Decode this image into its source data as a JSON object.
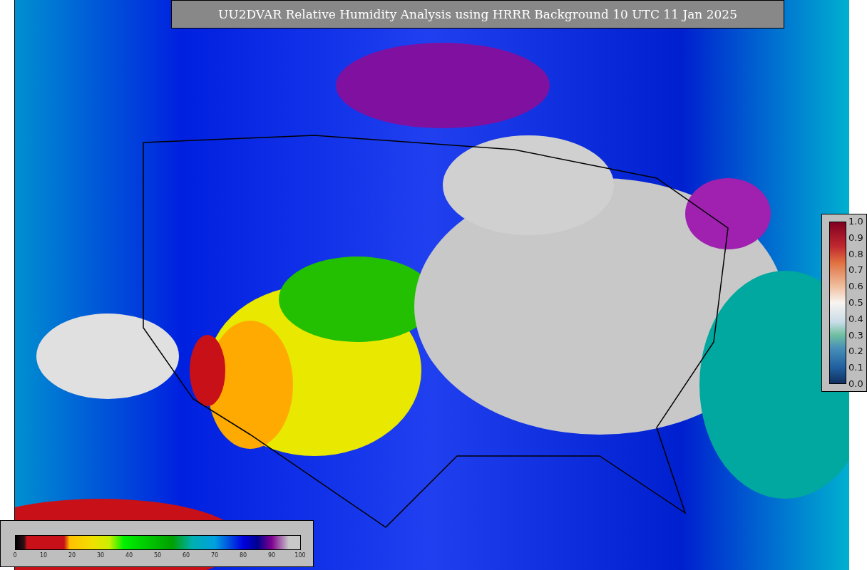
{
  "title": "UU2DVAR Relative Humidity Analysis using HRRR Background 10 UTC 11 Jan 2025",
  "humidity_colorbar": {
    "ticks": [
      "0",
      "10",
      "20",
      "30",
      "40",
      "50",
      "60",
      "70",
      "80",
      "90",
      "100"
    ]
  },
  "observation_colorbar": {
    "ticks": [
      "1.0",
      "0.9",
      "0.8",
      "0.7",
      "0.6",
      "0.5",
      "0.4",
      "0.3",
      "0.2",
      "0.1",
      "0.0"
    ]
  }
}
